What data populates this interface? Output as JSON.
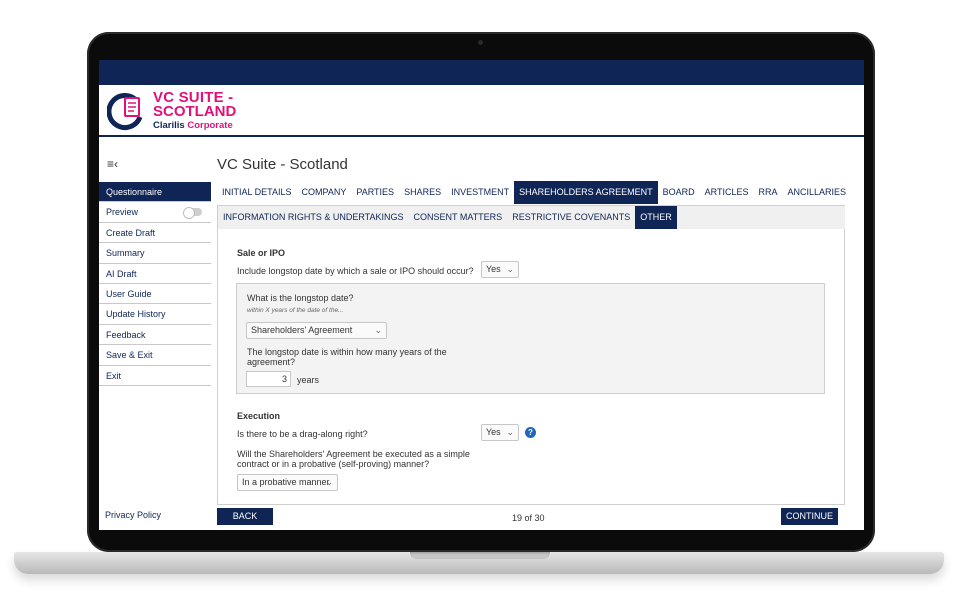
{
  "brand": {
    "line1": "VC SUITE -",
    "line2": "SCOTLAND",
    "sub_a": "Clarilis",
    "sub_b": "Corporate"
  },
  "sidebar": {
    "items": [
      {
        "label": "Questionnaire"
      },
      {
        "label": "Preview"
      },
      {
        "label": "Create Draft"
      },
      {
        "label": "Summary"
      },
      {
        "label": "AI Draft"
      },
      {
        "label": "User Guide"
      },
      {
        "label": "Update History"
      },
      {
        "label": "Feedback"
      },
      {
        "label": "Save & Exit"
      },
      {
        "label": "Exit"
      }
    ],
    "privacy": "Privacy Policy"
  },
  "main": {
    "title": "VC Suite - Scotland",
    "tabs": [
      {
        "label": "INITIAL DETAILS"
      },
      {
        "label": "COMPANY"
      },
      {
        "label": "PARTIES"
      },
      {
        "label": "SHARES"
      },
      {
        "label": "INVESTMENT"
      },
      {
        "label": "SHAREHOLDERS AGREEMENT"
      },
      {
        "label": "BOARD"
      },
      {
        "label": "ARTICLES"
      },
      {
        "label": "RRA"
      },
      {
        "label": "ANCILLARIES"
      }
    ],
    "subtabs": [
      {
        "label": "INFORMATION RIGHTS & UNDERTAKINGS"
      },
      {
        "label": "CONSENT MATTERS"
      },
      {
        "label": "RESTRICTIVE COVENANTS"
      },
      {
        "label": "OTHER"
      }
    ]
  },
  "form": {
    "sale_section": "Sale or IPO",
    "q_longstop": "Include longstop date by which a sale or IPO should occur?",
    "q_longstop_value": "Yes",
    "q_date": "What is the longstop date?",
    "q_date_hint": "within X years of the date of the...",
    "q_date_select": "Shareholders' Agreement",
    "q_years": "The longstop date is within how many years of the agreement?",
    "q_years_value": "3",
    "q_years_unit": "years",
    "execution_section": "Execution",
    "q_drag": "Is there to be a drag-along right?",
    "q_drag_value": "Yes",
    "q_exec": "Will the Shareholders' Agreement be executed as a simple contract or in a probative (self-proving) manner?",
    "q_exec_value": "In a probative manner"
  },
  "footer": {
    "back": "BACK",
    "page": "19 of 30",
    "continue": "CONTINUE"
  },
  "icons": {
    "help": "?",
    "chevron": "⌄",
    "menu": "≡‹"
  },
  "colors": {
    "navy": "#0f2556",
    "pink": "#e0127a"
  }
}
